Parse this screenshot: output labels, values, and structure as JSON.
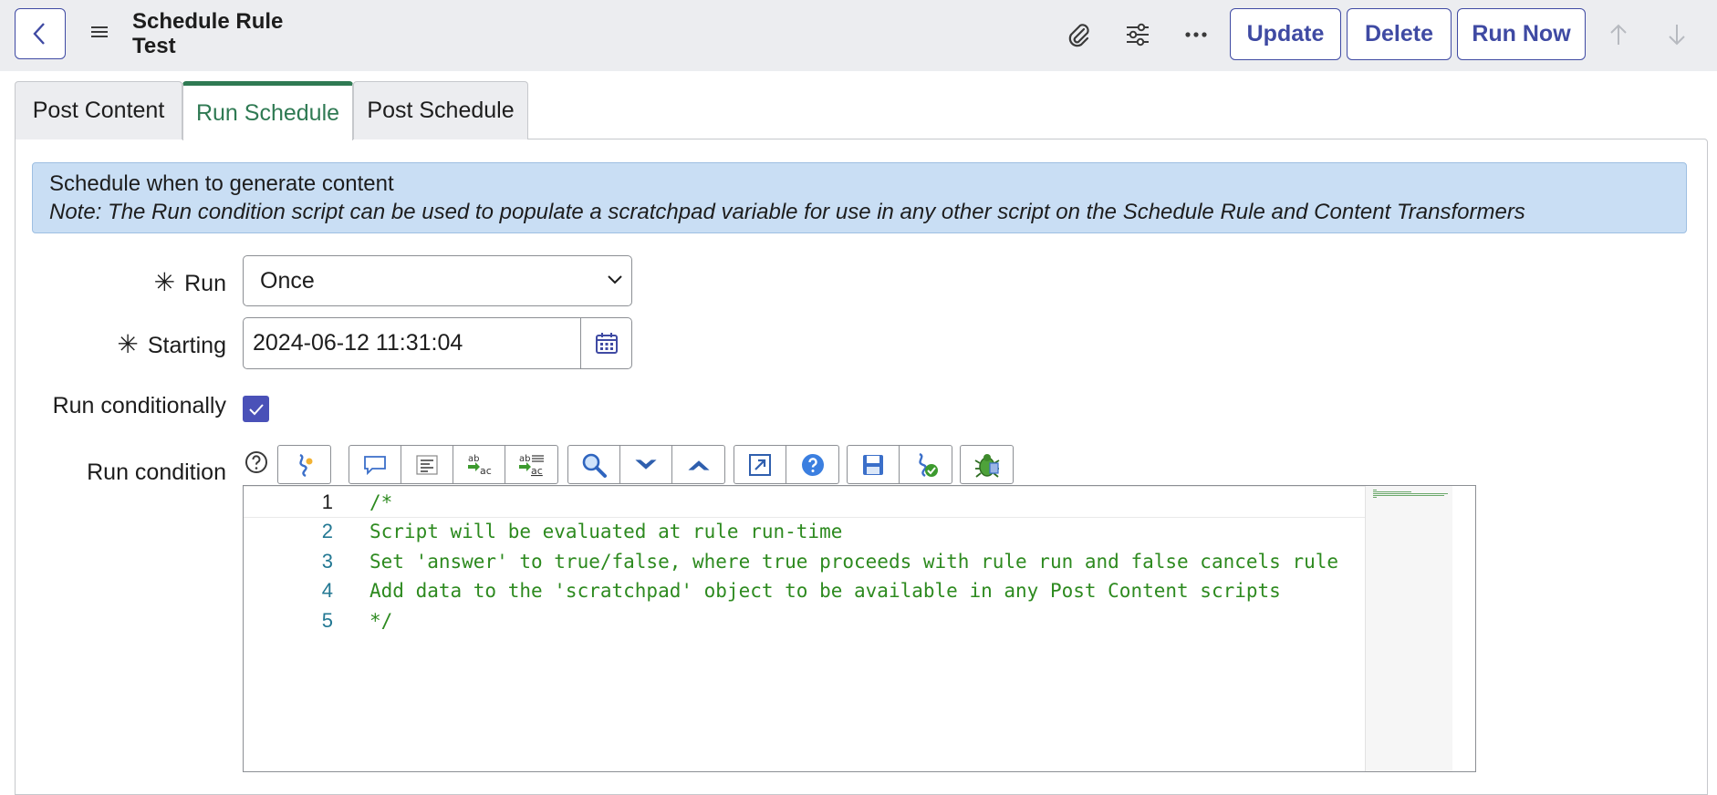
{
  "header": {
    "title": "Schedule Rule Test",
    "buttons": {
      "update": "Update",
      "delete": "Delete",
      "run_now": "Run Now"
    }
  },
  "tabs": [
    {
      "label": "Post Content"
    },
    {
      "label": "Run Schedule",
      "active": true
    },
    {
      "label": "Post Schedule"
    }
  ],
  "info": {
    "heading": "Schedule when to generate content",
    "note": "Note: The Run condition script can be used to populate a scratchpad variable for use in any other script on the Schedule Rule and Content Transformers"
  },
  "form": {
    "run_label": "Run",
    "run_value": "Once",
    "starting_label": "Starting",
    "starting_value": "2024-06-12 11:31:04",
    "run_conditionally_label": "Run conditionally",
    "run_conditionally_checked": true,
    "run_condition_label": "Run condition"
  },
  "editor": {
    "lines": [
      {
        "num": "1",
        "text": "/*"
      },
      {
        "num": "2",
        "text": "Script will be evaluated at rule run-time"
      },
      {
        "num": "3",
        "text": "Set 'answer' to true/false, where true proceeds with rule run and false cancels rule"
      },
      {
        "num": "4",
        "text": "Add data to the 'scratchpad' object to be available in any Post Content scripts"
      },
      {
        "num": "5",
        "text": "*/"
      }
    ]
  },
  "colors": {
    "accent": "#3f4aa3",
    "active_tab": "#2f7a53",
    "code_comment": "#2d8a1f",
    "info_bg": "#c9def4"
  }
}
